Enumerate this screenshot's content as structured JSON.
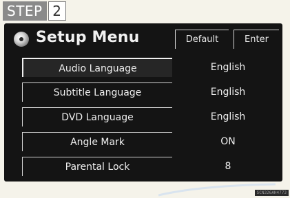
{
  "step": {
    "label": "STEP",
    "number": "2"
  },
  "header": {
    "title": "Setup Menu",
    "icon": "disc-icon",
    "default_label": "Default",
    "enter_label": "Enter"
  },
  "settings": [
    {
      "label": "Audio Language",
      "value": "English"
    },
    {
      "label": "Subtitle Language",
      "value": "English"
    },
    {
      "label": "DVD Language",
      "value": "English"
    },
    {
      "label": "Angle Mark",
      "value": "ON"
    },
    {
      "label": "Parental Lock",
      "value": "8"
    }
  ],
  "footer": {
    "code": "SCN326AH4773"
  },
  "colors": {
    "screen_bg": "#141414",
    "text": "#efefef",
    "page_bg": "#f5f3ea",
    "step_badge": "#8a8a8a"
  }
}
